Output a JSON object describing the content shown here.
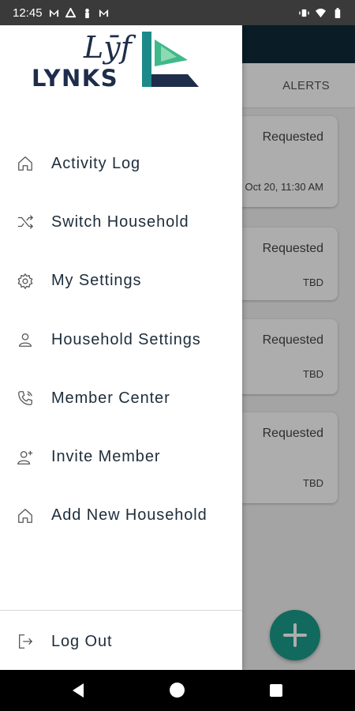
{
  "status_bar": {
    "time": "12:45",
    "left_icons": [
      "gmail-icon",
      "recycle-icon",
      "person-icon",
      "gmail-icon"
    ],
    "right_icons": [
      "vibrate-icon",
      "wifi-icon",
      "battery-icon"
    ]
  },
  "background_app": {
    "tab_label": "ALERTS",
    "cards": [
      {
        "status": "Requested",
        "date": "Oct 20, 11:30 AM"
      },
      {
        "status": "Requested",
        "date": "TBD"
      },
      {
        "status": "Requested",
        "date": "TBD"
      },
      {
        "status": "Requested",
        "date": "TBD"
      }
    ],
    "fab_color": "#1a9c8a"
  },
  "drawer": {
    "logo": {
      "top_text": "Lȳf",
      "bottom_text": "LYNKS"
    },
    "menu_items": [
      {
        "label": "Activity Log",
        "icon": "home-icon"
      },
      {
        "label": "Switch Household",
        "icon": "shuffle-icon"
      },
      {
        "label": "My Settings",
        "icon": "gear-icon"
      },
      {
        "label": "Household Settings",
        "icon": "person-icon"
      },
      {
        "label": "Member Center",
        "icon": "phone-icon"
      },
      {
        "label": "Invite Member",
        "icon": "add-person-icon"
      },
      {
        "label": "Add New Household",
        "icon": "home-icon"
      }
    ],
    "logout_label": "Log Out"
  },
  "colors": {
    "text": "#1e2d3b",
    "brand_navy": "#1e2d4a",
    "brand_teal": "#1d8a8a",
    "brand_green": "#3fb98a",
    "appbar": "#0f2a38"
  }
}
